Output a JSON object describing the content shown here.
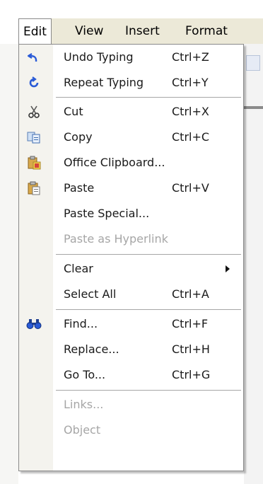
{
  "menubar": {
    "items": [
      {
        "label": "Edit",
        "open": true
      },
      {
        "label": "View"
      },
      {
        "label": "Insert"
      },
      {
        "label": "Format"
      }
    ]
  },
  "menu": {
    "items": [
      {
        "label": "Undo Typing",
        "shortcut": "Ctrl+Z",
        "icon": "undo-icon"
      },
      {
        "label": "Repeat Typing",
        "shortcut": "Ctrl+Y",
        "icon": "repeat-icon"
      },
      {
        "label": "Cut",
        "shortcut": "Ctrl+X",
        "icon": "scissors-icon"
      },
      {
        "label": "Copy",
        "shortcut": "Ctrl+C",
        "icon": "copy-icon"
      },
      {
        "label": "Office Clipboard...",
        "shortcut": "",
        "icon": "clipboard-icon"
      },
      {
        "label": "Paste",
        "shortcut": "Ctrl+V",
        "icon": "paste-icon"
      },
      {
        "label": "Paste Special...",
        "shortcut": ""
      },
      {
        "label": "Paste as Hyperlink",
        "shortcut": "",
        "disabled": true
      },
      {
        "label": "Clear",
        "shortcut": "",
        "submenu": true
      },
      {
        "label": "Select All",
        "shortcut": "Ctrl+A"
      },
      {
        "label": "Find...",
        "shortcut": "Ctrl+F",
        "icon": "binoculars-icon"
      },
      {
        "label": "Replace...",
        "shortcut": "Ctrl+H"
      },
      {
        "label": "Go To...",
        "shortcut": "Ctrl+G"
      },
      {
        "label": "Links...",
        "shortcut": "",
        "disabled": true
      },
      {
        "label": "Object",
        "shortcut": "",
        "disabled": true
      }
    ]
  },
  "colors": {
    "menubar_bg": "#ece9d8",
    "gutter_bg": "#f4f3ee",
    "disabled_text": "#a6a6a6",
    "undo_icon": "#2a5bd7"
  }
}
